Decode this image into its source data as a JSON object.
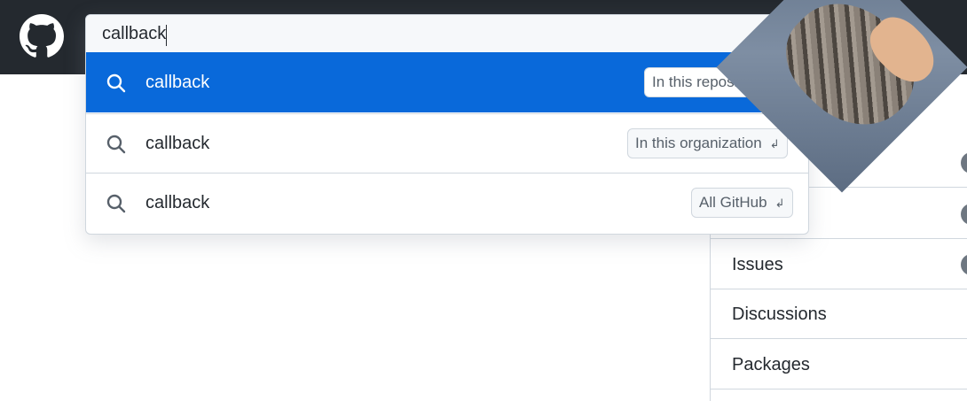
{
  "search": {
    "value": "callback",
    "results": [
      {
        "text": "callback",
        "scope": "In this repository"
      },
      {
        "text": "callback",
        "scope": "In this organization"
      },
      {
        "text": "callback",
        "scope": "All GitHub"
      }
    ],
    "enter_symbol": "↲"
  },
  "sidebar": {
    "items": [
      {
        "label": ""
      },
      {
        "label": ""
      },
      {
        "label": "Issues"
      },
      {
        "label": "Discussions"
      },
      {
        "label": "Packages"
      }
    ]
  },
  "colors": {
    "header_bg": "#24292f",
    "active_result": "#0969da"
  },
  "icons": {
    "logo": "github-mark-icon",
    "search": "search-icon",
    "enter": "enter-key-icon"
  }
}
